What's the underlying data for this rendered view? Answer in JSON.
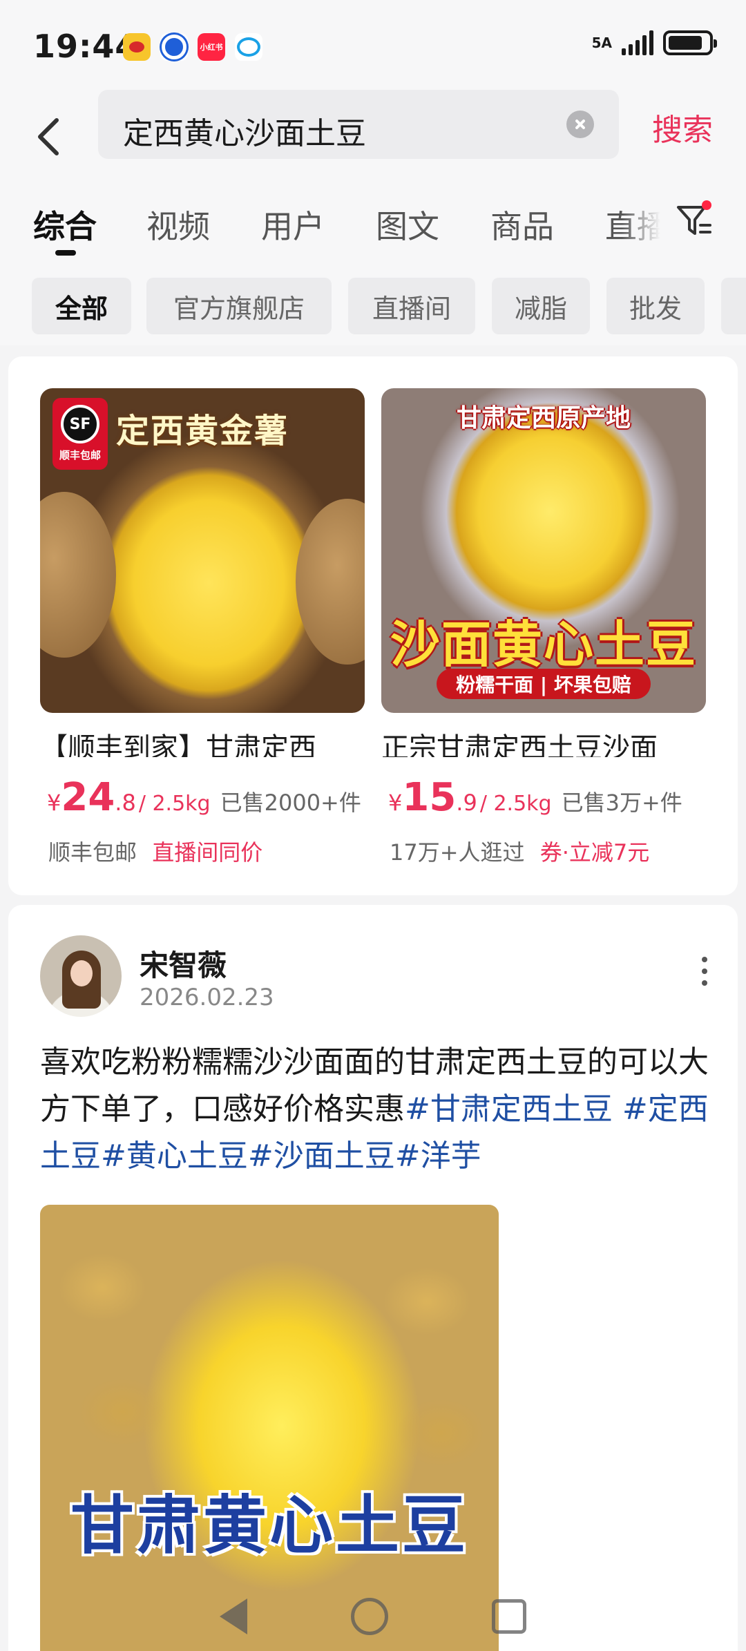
{
  "status_bar": {
    "time": "19:44",
    "apps": [
      "weibo-icon",
      "baidu-icon",
      "xiaohongshu-icon",
      "chat-icon"
    ],
    "xhs_label": "小红书",
    "network": "5A",
    "battery_level": 0.85
  },
  "search": {
    "query": "定西黄心沙面土豆",
    "submit_label": "搜索"
  },
  "tabs": [
    "综合",
    "视频",
    "用户",
    "图文",
    "商品",
    "直播"
  ],
  "active_tab": "综合",
  "chips": [
    "全部",
    "官方旗舰店",
    "直播间",
    "减脂",
    "批发"
  ],
  "active_chip": "全部",
  "products": [
    {
      "image_badge": "顺丰包邮",
      "image_badge_logo": "SF",
      "image_title": "定西黄金薯",
      "title": "【顺丰到家】甘肃定西",
      "currency": "¥",
      "price_int": "24",
      "price_dec": ".8",
      "unit": "/ 2.5kg",
      "sold": "已售2000+件",
      "meta_gray": "顺丰包邮",
      "meta_red": "直播间同价"
    },
    {
      "image_title": "甘肃定西原产地",
      "image_main": "沙面黄心土豆",
      "image_sub": "粉糯干面 | 坏果包赔",
      "title": "正宗甘肃定西土豆沙面",
      "currency": "¥",
      "price_int": "15",
      "price_dec": ".9",
      "unit": "/ 2.5kg",
      "sold": "已售3万+件",
      "meta_gray": "17万+人逛过",
      "meta_red": "券·立减7元"
    }
  ],
  "post": {
    "author": "宋智薇",
    "date": "2026.02.23",
    "text": "喜欢吃粉粉糯糯沙沙面面的甘肃定西土豆的可以大方下单了，口感好价格实惠",
    "hashtags": "#甘肃定西土豆 #定西土豆#黄心土豆#沙面土豆#洋芋",
    "image_caption": "甘肃黄心土豆"
  },
  "colors": {
    "accent": "#e9325a",
    "hashtag": "#1f4fa3",
    "background": "#f4f4f5"
  }
}
